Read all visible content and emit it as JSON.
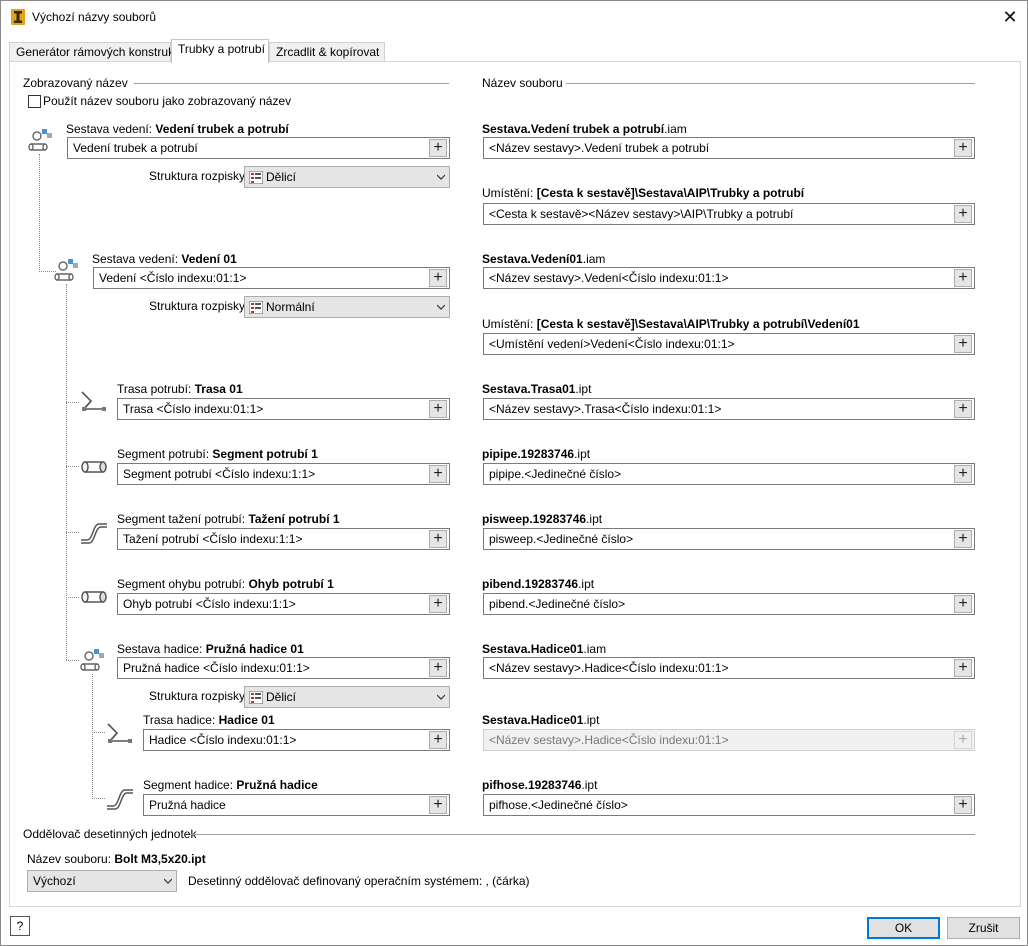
{
  "window": {
    "title": "Výchozí názvy souborů",
    "close_glyph": "✕"
  },
  "tabs": [
    {
      "label": "Generátor rámových konstrukcí"
    },
    {
      "label": "Trubky a potrubí"
    },
    {
      "label": "Zrcadlit & kopírovat"
    }
  ],
  "left_section": "Zobrazovaný název",
  "right_section": "Název souboru",
  "use_filename_checkbox": {
    "label": "Použít název souboru jako zobrazovaný název",
    "checked": false
  },
  "bom_label": "Struktura rozpisky",
  "location_label": "Umístění:",
  "rows": {
    "assembly": {
      "label": "Sestava vedení:",
      "name": "Vedení trubek a potrubí",
      "value": "Vedení trubek a potrubí",
      "file_bold": "Sestava.Vedení trubek a potrubí",
      "file_ext": ".iam",
      "file_value": "<Název sestavy>.Vedení trubek a potrubí",
      "bom": "Dělicí",
      "location_bold": "[Cesta k sestavě]\\Sestava\\AIP\\Trubky a potrubí",
      "location_value": "<Cesta k sestavě><Název sestavy>\\AIP\\Trubky a potrubí"
    },
    "run": {
      "label": "Sestava vedení:",
      "name": "Vedení 01",
      "value": "Vedení <Číslo indexu:01:1>",
      "file_bold": "Sestava.Vedení01",
      "file_ext": ".iam",
      "file_value": "<Název sestavy>.Vedení<Číslo indexu:01:1>",
      "bom": "Normální",
      "location_bold": "[Cesta k sestavě]\\Sestava\\AIP\\Trubky a potrubí\\Vedení01",
      "location_value": "<Umístění vedení>Vedení<Číslo indexu:01:1>"
    },
    "route": {
      "label": "Trasa potrubí:",
      "name": "Trasa 01",
      "value": "Trasa <Číslo indexu:01:1>",
      "file_bold": "Sestava.Trasa01",
      "file_ext": ".ipt",
      "file_value": "<Název sestavy>.Trasa<Číslo indexu:01:1>"
    },
    "segment": {
      "label": "Segment potrubí:",
      "name": "Segment potrubí 1",
      "value": "Segment potrubí <Číslo indexu:1:1>",
      "file_bold": "pipipe.19283746",
      "file_ext": ".ipt",
      "file_value": "pipipe.<Jedinečné číslo>"
    },
    "sweep": {
      "label": "Segment tažení potrubí:",
      "name": "Tažení potrubí 1",
      "value": "Tažení potrubí <Číslo indexu:1:1>",
      "file_bold": "pisweep.19283746",
      "file_ext": ".ipt",
      "file_value": "pisweep.<Jedinečné číslo>"
    },
    "bend": {
      "label": "Segment ohybu potrubí:",
      "name": "Ohyb potrubí 1",
      "value": "Ohyb potrubí <Číslo indexu:1:1>",
      "file_bold": "pibend.19283746",
      "file_ext": ".ipt",
      "file_value": "pibend.<Jedinečné číslo>"
    },
    "hose_asm": {
      "label": "Sestava hadice:",
      "name": "Pružná hadice 01",
      "value": "Pružná hadice <Číslo indexu:01:1>",
      "file_bold": "Sestava.Hadice01",
      "file_ext": ".iam",
      "file_value": "<Název sestavy>.Hadice<Číslo indexu:01:1>",
      "bom": "Dělicí"
    },
    "hose_route": {
      "label": "Trasa hadice:",
      "name": "Hadice 01",
      "value": "Hadice <Číslo indexu:01:1>",
      "file_bold": "Sestava.Hadice01",
      "file_ext": ".ipt",
      "file_value": "<Název sestavy>.Hadice<Číslo indexu:01:1>"
    },
    "hose_seg": {
      "label": "Segment hadice:",
      "name": "Pružná hadice",
      "value": "Pružná hadice",
      "file_bold": "pifhose.19283746",
      "file_ext": ".ipt",
      "file_value": "pifhose.<Jedinečné číslo>"
    }
  },
  "decimal": {
    "section": "Oddělovač desetinných jednotek",
    "filename_label": "Název souboru:",
    "filename_value": "Bolt M3,5x20.ipt",
    "select": "Výchozí",
    "description": "Desetinný oddělovač definovaný operačním systémem: , (čárka)"
  },
  "buttons": {
    "help": "?",
    "ok": "OK",
    "cancel": "Zrušit",
    "plus": "+"
  }
}
